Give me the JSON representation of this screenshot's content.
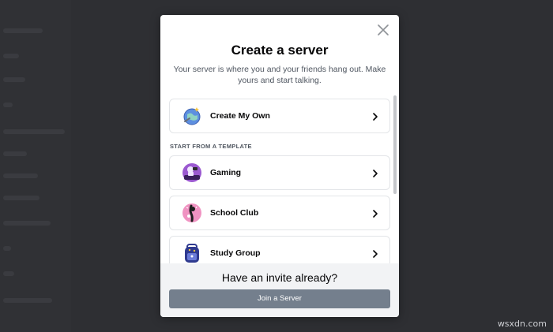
{
  "modal": {
    "title": "Create a server",
    "subtitle": "Your server is where you and your friends hang out. Make yours and start talking.",
    "close_icon": "close-icon"
  },
  "options": [
    {
      "label": "Create My Own",
      "icon": "globe-icon"
    },
    {
      "label": "Gaming",
      "icon": "gaming-icon"
    },
    {
      "label": "School Club",
      "icon": "school-club-icon"
    },
    {
      "label": "Study Group",
      "icon": "backpack-icon"
    }
  ],
  "template_section_label": "START FROM A TEMPLATE",
  "footer": {
    "title": "Have an invite already?",
    "button_label": "Join a Server",
    "button_color": "#747f8d"
  },
  "watermark": "wsxdn.com"
}
